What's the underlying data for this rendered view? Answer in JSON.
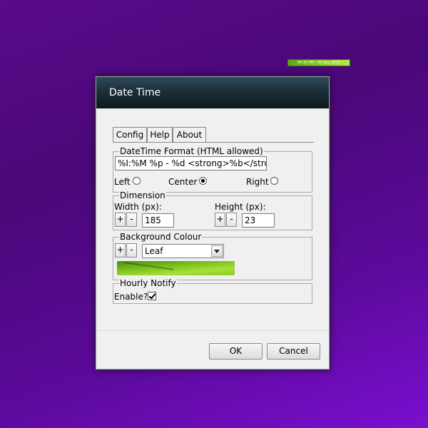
{
  "desktop_gadget": {
    "text": "04:35 PM - 09 Nov 2015"
  },
  "dialog": {
    "title": "Date Time",
    "tabs": [
      {
        "label": "Config",
        "selected": true
      },
      {
        "label": "Help"
      },
      {
        "label": "About"
      }
    ],
    "datetime_format": {
      "legend": "DateTime Format (HTML allowed)",
      "value": "%I:%M %p - %d <strong>%b</strong> %Y",
      "alignment": {
        "left_label": "Left",
        "center_label": "Center",
        "right_label": "Right",
        "selected": "center"
      }
    },
    "dimension": {
      "legend": "Dimension",
      "width_label": "Width (px):",
      "width_value": "185",
      "height_label": "Height (px):",
      "height_value": "23",
      "plus_label": "+",
      "minus_label": "-"
    },
    "background_colour": {
      "legend": "Background Colour",
      "plus_label": "+",
      "minus_label": "-",
      "selected": "Leaf"
    },
    "hourly_notify": {
      "legend": "Hourly Notify",
      "enable_label": "Enable?",
      "enabled": true
    },
    "buttons": {
      "ok": "OK",
      "cancel": "Cancel"
    }
  }
}
